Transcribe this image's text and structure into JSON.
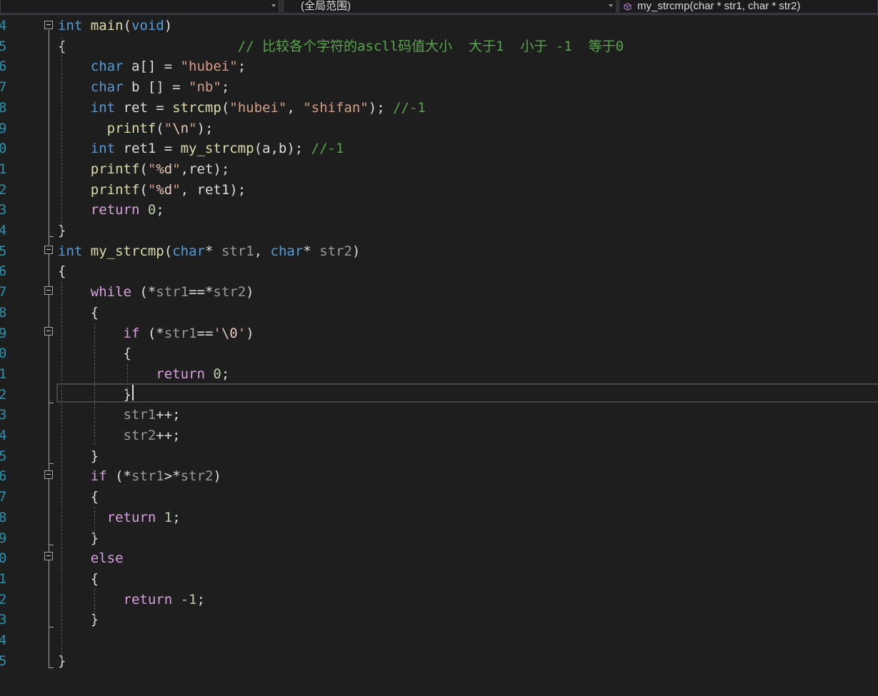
{
  "navbar": {
    "project_dropdown": "",
    "scope_dropdown": "(全局范围)",
    "member_dropdown": "my_strcmp(char * str1, char * str2)",
    "member_icon": "cube-icon"
  },
  "editor": {
    "lines": [
      {
        "n": "4",
        "tokens": [
          [
            "kw",
            "int"
          ],
          [
            "plain",
            " "
          ],
          [
            "fn",
            "main"
          ],
          [
            "plain",
            "("
          ],
          [
            "kw",
            "void"
          ],
          [
            "plain",
            ")"
          ]
        ]
      },
      {
        "n": "5",
        "tokens": [
          [
            "plain",
            "{                     "
          ],
          [
            "cmt",
            "// 比较各个字符的ascll码值大小  大于1  小于 -1  等于0"
          ]
        ]
      },
      {
        "n": "6",
        "tokens": [
          [
            "plain",
            "    "
          ],
          [
            "kw",
            "char"
          ],
          [
            "plain",
            " a[] = "
          ],
          [
            "str",
            "\"hubei\""
          ],
          [
            "plain",
            ";"
          ]
        ]
      },
      {
        "n": "7",
        "tokens": [
          [
            "plain",
            "    "
          ],
          [
            "kw",
            "char"
          ],
          [
            "plain",
            " b [] = "
          ],
          [
            "str",
            "\"nb\""
          ],
          [
            "plain",
            ";"
          ]
        ]
      },
      {
        "n": "8",
        "tokens": [
          [
            "plain",
            "    "
          ],
          [
            "kw",
            "int"
          ],
          [
            "plain",
            " ret = "
          ],
          [
            "fn",
            "strcmp"
          ],
          [
            "plain",
            "("
          ],
          [
            "str",
            "\"hubei\""
          ],
          [
            "plain",
            ", "
          ],
          [
            "str",
            "\"shifan\""
          ],
          [
            "plain",
            "); "
          ],
          [
            "cmt",
            "//-1"
          ]
        ]
      },
      {
        "n": "9",
        "tokens": [
          [
            "plain",
            "      "
          ],
          [
            "fn",
            "printf"
          ],
          [
            "plain",
            "("
          ],
          [
            "str",
            "\""
          ],
          [
            "esc",
            "\\n"
          ],
          [
            "str",
            "\""
          ],
          [
            "plain",
            ");"
          ]
        ]
      },
      {
        "n": "0",
        "tokens": [
          [
            "plain",
            "    "
          ],
          [
            "kw",
            "int"
          ],
          [
            "plain",
            " ret1 = "
          ],
          [
            "fn",
            "my_strcmp"
          ],
          [
            "plain",
            "(a,b); "
          ],
          [
            "cmt",
            "//-1"
          ]
        ]
      },
      {
        "n": "1",
        "tokens": [
          [
            "plain",
            "    "
          ],
          [
            "fn",
            "printf"
          ],
          [
            "plain",
            "("
          ],
          [
            "str",
            "\""
          ],
          [
            "esc",
            "%d"
          ],
          [
            "str",
            "\""
          ],
          [
            "plain",
            ",ret);"
          ]
        ]
      },
      {
        "n": "2",
        "tokens": [
          [
            "plain",
            "    "
          ],
          [
            "fn",
            "printf"
          ],
          [
            "plain",
            "("
          ],
          [
            "str",
            "\""
          ],
          [
            "esc",
            "%d"
          ],
          [
            "str",
            "\""
          ],
          [
            "plain",
            ", ret1);"
          ]
        ]
      },
      {
        "n": "3",
        "tokens": [
          [
            "plain",
            "    "
          ],
          [
            "ctl",
            "return"
          ],
          [
            "plain",
            " "
          ],
          [
            "num",
            "0"
          ],
          [
            "plain",
            ";"
          ]
        ]
      },
      {
        "n": "4",
        "tokens": [
          [
            "plain",
            "}"
          ]
        ]
      },
      {
        "n": "5",
        "tokens": [
          [
            "kw",
            "int"
          ],
          [
            "plain",
            " "
          ],
          [
            "fn",
            "my_strcmp"
          ],
          [
            "plain",
            "("
          ],
          [
            "kw",
            "char"
          ],
          [
            "plain",
            "* "
          ],
          [
            "param",
            "str1"
          ],
          [
            "plain",
            ", "
          ],
          [
            "kw",
            "char"
          ],
          [
            "plain",
            "* "
          ],
          [
            "param",
            "str2"
          ],
          [
            "plain",
            ")"
          ]
        ]
      },
      {
        "n": "6",
        "tokens": [
          [
            "plain",
            "{"
          ]
        ]
      },
      {
        "n": "7",
        "tokens": [
          [
            "plain",
            "    "
          ],
          [
            "ctl",
            "while"
          ],
          [
            "plain",
            " (*"
          ],
          [
            "param",
            "str1"
          ],
          [
            "plain",
            "==*"
          ],
          [
            "param",
            "str2"
          ],
          [
            "plain",
            ")"
          ]
        ]
      },
      {
        "n": "8",
        "tokens": [
          [
            "plain",
            "    {"
          ]
        ]
      },
      {
        "n": "9",
        "tokens": [
          [
            "plain",
            "        "
          ],
          [
            "ctl",
            "if"
          ],
          [
            "plain",
            " (*"
          ],
          [
            "param",
            "str1"
          ],
          [
            "plain",
            "=="
          ],
          [
            "chr",
            "'"
          ],
          [
            "esc",
            "\\0"
          ],
          [
            "chr",
            "'"
          ],
          [
            "plain",
            ")"
          ]
        ]
      },
      {
        "n": "0",
        "tokens": [
          [
            "plain",
            "        {"
          ]
        ]
      },
      {
        "n": "1",
        "tokens": [
          [
            "plain",
            "            "
          ],
          [
            "ctl",
            "return"
          ],
          [
            "plain",
            " "
          ],
          [
            "num",
            "0"
          ],
          [
            "plain",
            ";"
          ]
        ]
      },
      {
        "n": "2",
        "tokens": [
          [
            "plain",
            "        }"
          ]
        ]
      },
      {
        "n": "3",
        "tokens": [
          [
            "plain",
            "        "
          ],
          [
            "param",
            "str1"
          ],
          [
            "plain",
            "++;"
          ]
        ]
      },
      {
        "n": "4",
        "tokens": [
          [
            "plain",
            "        "
          ],
          [
            "param",
            "str2"
          ],
          [
            "plain",
            "++;"
          ]
        ]
      },
      {
        "n": "5",
        "tokens": [
          [
            "plain",
            "    }"
          ]
        ]
      },
      {
        "n": "6",
        "tokens": [
          [
            "plain",
            "    "
          ],
          [
            "ctl",
            "if"
          ],
          [
            "plain",
            " (*"
          ],
          [
            "param",
            "str1"
          ],
          [
            "plain",
            ">*"
          ],
          [
            "param",
            "str2"
          ],
          [
            "plain",
            ")"
          ]
        ]
      },
      {
        "n": "7",
        "tokens": [
          [
            "plain",
            "    {"
          ]
        ]
      },
      {
        "n": "8",
        "tokens": [
          [
            "plain",
            "      "
          ],
          [
            "ctl",
            "return"
          ],
          [
            "plain",
            " "
          ],
          [
            "num",
            "1"
          ],
          [
            "plain",
            ";"
          ]
        ]
      },
      {
        "n": "9",
        "tokens": [
          [
            "plain",
            "    }"
          ]
        ]
      },
      {
        "n": "0",
        "tokens": [
          [
            "plain",
            "    "
          ],
          [
            "ctl",
            "else"
          ]
        ]
      },
      {
        "n": "1",
        "tokens": [
          [
            "plain",
            "    {"
          ]
        ]
      },
      {
        "n": "2",
        "tokens": [
          [
            "plain",
            "        "
          ],
          [
            "ctl",
            "return"
          ],
          [
            "plain",
            " "
          ],
          [
            "num",
            "-1"
          ],
          [
            "plain",
            ";"
          ]
        ]
      },
      {
        "n": "3",
        "tokens": [
          [
            "plain",
            "    }"
          ]
        ]
      },
      {
        "n": "4",
        "tokens": []
      },
      {
        "n": "5",
        "tokens": [
          [
            "plain",
            "}"
          ]
        ]
      }
    ]
  }
}
